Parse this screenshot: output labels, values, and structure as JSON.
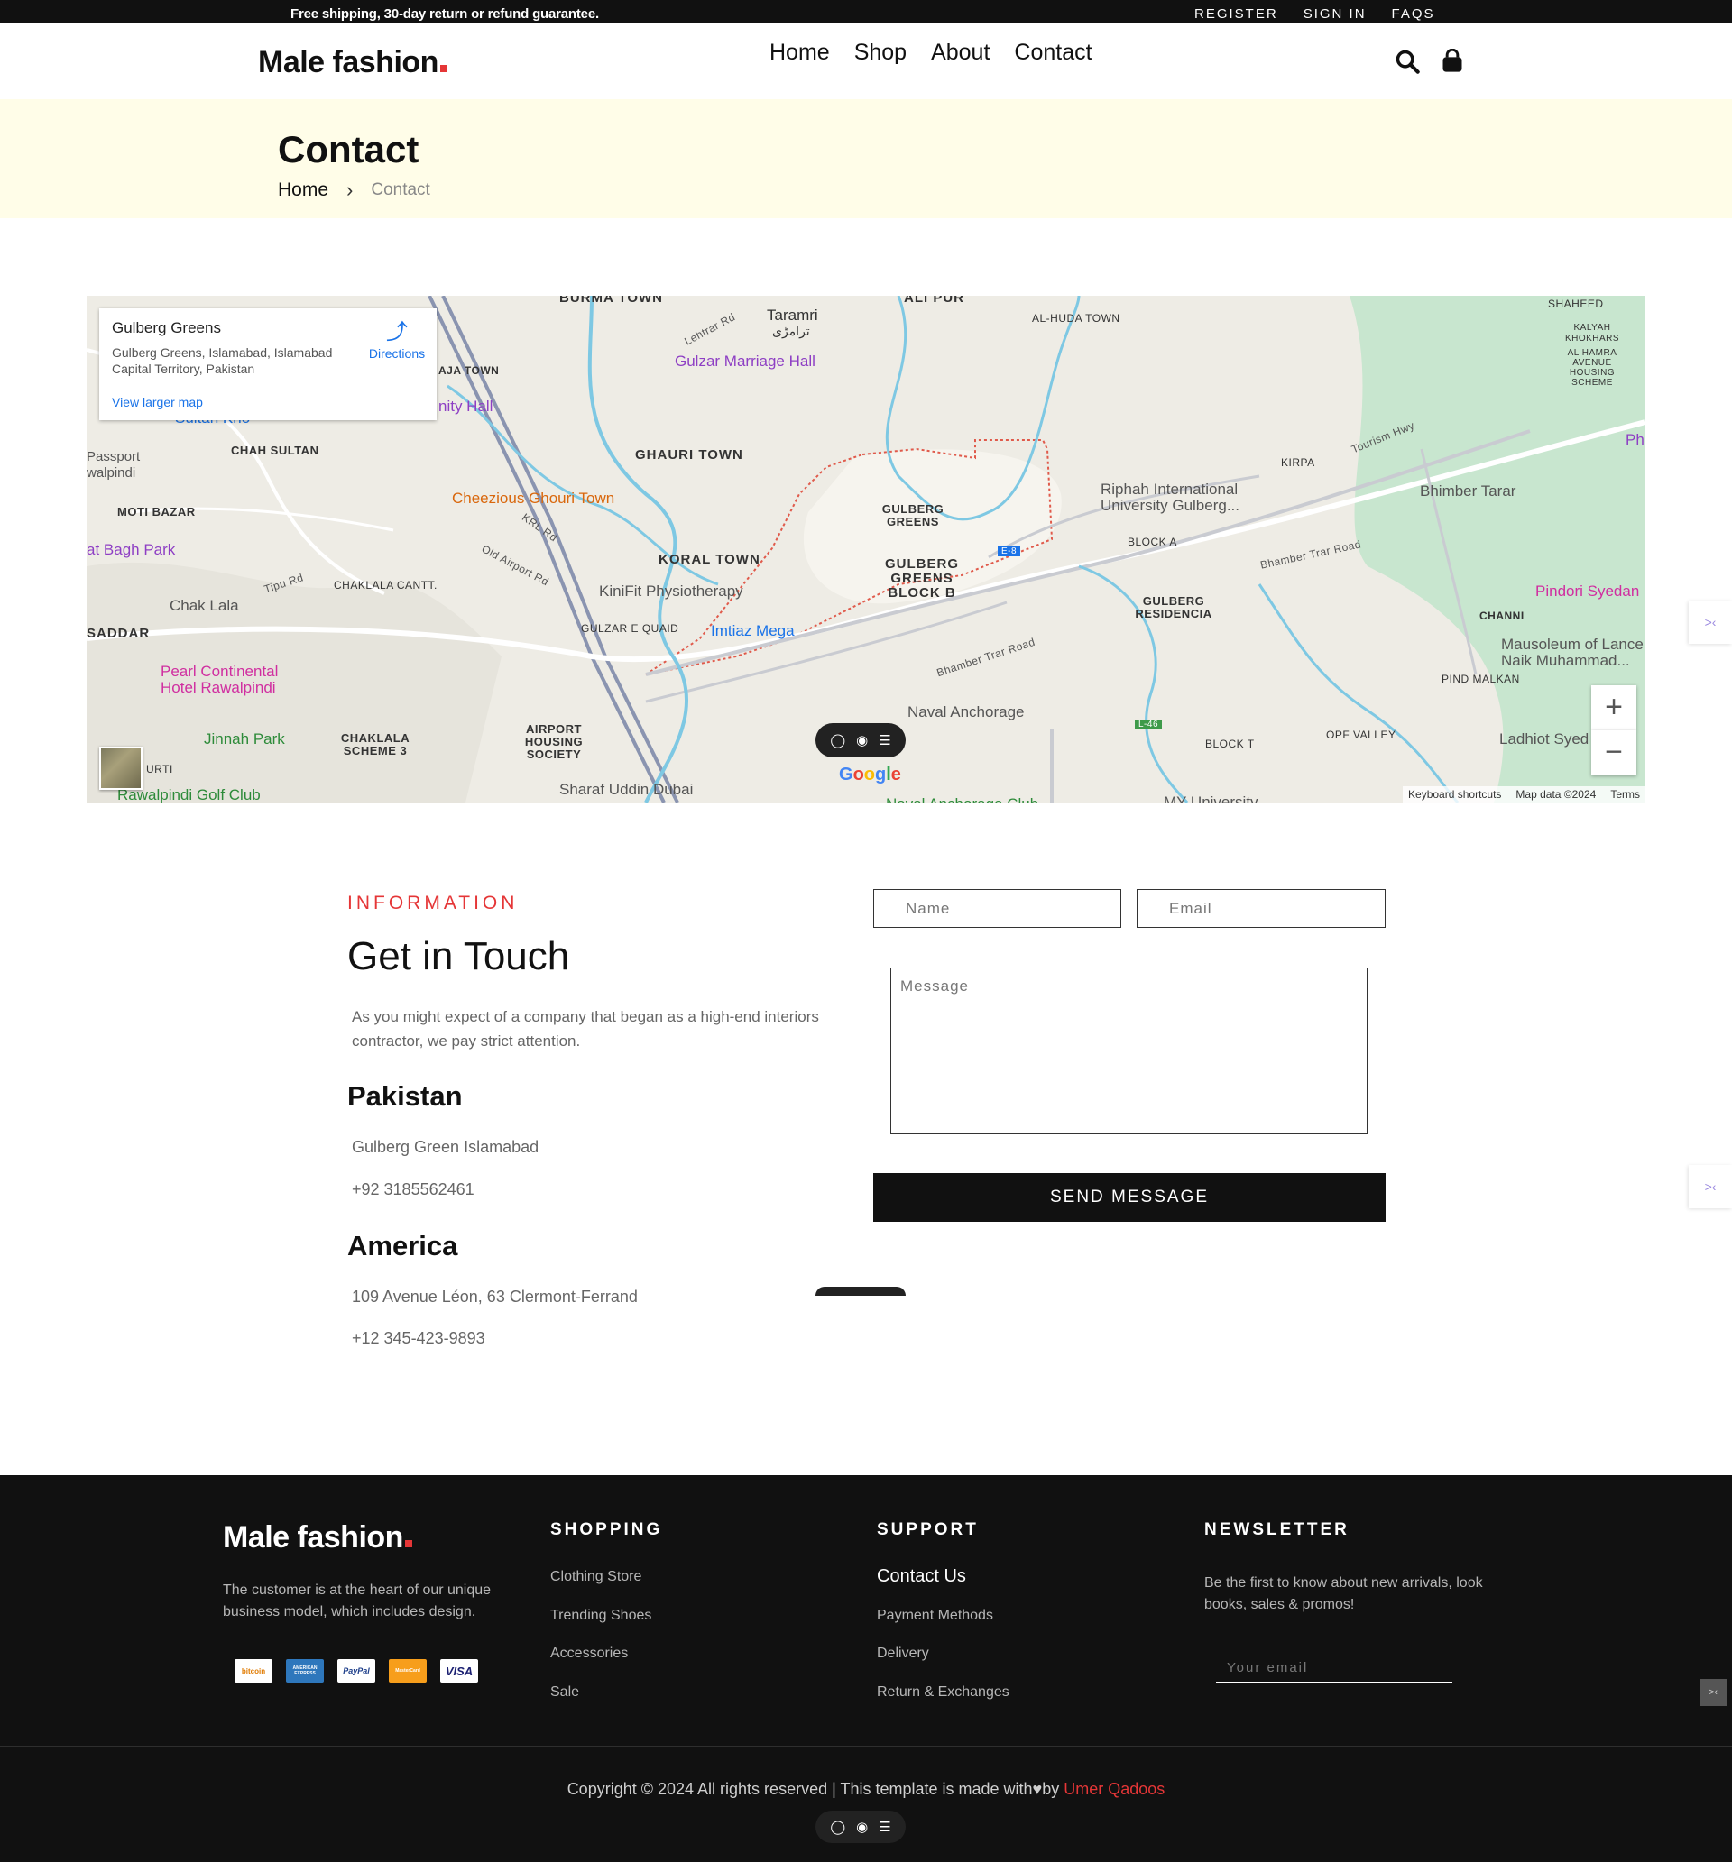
{
  "topbar": {
    "promo": "Free shipping, 30-day return or refund guarantee.",
    "links": [
      "REGISTER",
      "SIGN IN",
      "FAQS"
    ]
  },
  "header": {
    "logo_text": "Male fashion",
    "nav": [
      "Home",
      "Shop",
      "About",
      "Contact"
    ],
    "icons": [
      "search-icon",
      "shopping-bag-icon"
    ]
  },
  "breadcrumb": {
    "title": "Contact",
    "home": "Home",
    "current": "Contact"
  },
  "map": {
    "card_title": "Gulberg Greens",
    "card_address": "Gulberg Greens, Islamabad, Islamabad Capital Territory, Pakistan",
    "directions": "Directions",
    "view_larger": "View larger map",
    "footer": [
      "Keyboard shortcuts",
      "Map data ©2024",
      "Terms"
    ],
    "labels": {
      "burma_town": "BURMA TOWN",
      "ali_pur": "ALI PUR",
      "al_huda_town": "AL-HUDA TOWN",
      "shaheed": "SHAHEED",
      "kalyah_khokhars": "KALYAH KHOKHARS",
      "al_hamra": "AL HAMRA AVENUE HOUSING SCHEME",
      "taramri": "Taramri",
      "taramri_ur": "ترامڑی",
      "lehtrar_rd": "Lehtrar Rd",
      "gulzar_hall": "Gulzar Marriage Hall",
      "aja_town": "AJA TOWN",
      "nity_hall": "nity Hall",
      "sultan_kho": "Sultan Kho",
      "passport": "Passport walpindi",
      "chah_sultan": "CHAH SULTAN",
      "ghauri_town": "GHAURI TOWN",
      "kirpa": "KIRPA",
      "tourism_hwy": "Tourism Hwy",
      "ph": "Ph",
      "cheezious": "Cheezious Ghouri Town",
      "riphah": "Riphah International University Gulberg...",
      "bhimber_tarar": "Bhimber Tarar",
      "moti_bazar": "MOTI BAZAR",
      "krl_rd": "KRL Rd",
      "gulberg_greens": "GULBERG GREENS",
      "block_a": "BLOCK A",
      "bagh_park": "at Bagh Park",
      "koral_town": "KORAL TOWN",
      "old_airport": "Old Airport Rd",
      "gulberg_block_b": "GULBERG GREENS BLOCK B",
      "bhamber_trar": "Bhamber Trar Road",
      "tipu_rd": "Tipu Rd",
      "chaklala_cantt": "CHAKLALA CANTT.",
      "kinifit": "KiniFit Physiotherapy",
      "gulberg_residencia": "GULBERG RESIDENCIA",
      "pindori": "Pindori Syedan",
      "chak_lala": "Chak Lala",
      "gulzar_quaid": "GULZAR E QUAID",
      "imtiaz": "Imtiaz Mega",
      "channi": "CHANNI",
      "saddar": "SADDAR",
      "mausoleum": "Mausoleum of Lance Naik Muhammad...",
      "pearl": "Pearl Continental Hotel Rawalpindi",
      "bhamber_trar_2": "Bhamber Trar Road",
      "pind_malkan": "PIND MALKAN",
      "naval_anchorage": "Naval Anchorage",
      "l46": "L-46",
      "e8": "E-8",
      "block_t": "BLOCK T",
      "opf_valley": "OPF VALLEY",
      "ladhiot": "Ladhiot Syed",
      "jinnah_park": "Jinnah Park",
      "chaklala_3": "CHAKLALA SCHEME 3",
      "airport_housing": "AIRPORT HOUSING SOCIETY",
      "rawalpindi_golf": "Rawalpindi Golf Club",
      "sharaf": "Sharaf Uddin Dubai",
      "urti": "URTI",
      "my_university": "MY University",
      "naval_club": "Naval Anchorage Club"
    }
  },
  "contact": {
    "tag": "INFORMATION",
    "heading": "Get in Touch",
    "intro": "As you might expect of a company that began as a high-end interiors contractor, we pay strict attention.",
    "offices": [
      {
        "country": "Pakistan",
        "address": "Gulberg Green Islamabad",
        "phone": "+92 3185562461"
      },
      {
        "country": "America",
        "address": "109 Avenue Léon, 63 Clermont-Ferrand",
        "phone": "+12 345-423-9893"
      }
    ],
    "form": {
      "name_placeholder": "Name",
      "email_placeholder": "Email",
      "message_placeholder": "Message",
      "submit": "SEND MESSAGE"
    }
  },
  "footer": {
    "logo_text": "Male fashion",
    "about": "The customer is at the heart of our unique business model, which includes design.",
    "payments": [
      "bitcoin",
      "AMERICAN EXPRESS",
      "PayPal",
      "MasterCard",
      "VISA"
    ],
    "shopping": {
      "title": "SHOPPING",
      "links": [
        "Clothing Store",
        "Trending Shoes",
        "Accessories",
        "Sale"
      ]
    },
    "support": {
      "title": "SUPPORT",
      "links": [
        "Contact Us",
        "Payment Methods",
        "Delivery",
        "Return & Exchanges"
      ]
    },
    "newsletter": {
      "title": "NEWSLETTER",
      "text": "Be the first to know about new arrivals, look books, sales & promos!",
      "placeholder": "Your email"
    },
    "copyright": "Copyright © 2024 All rights reserved | This template is made with",
    "by": "by",
    "author": "Umer Qadoos"
  },
  "colors": {
    "accent": "#e53637",
    "dark": "#111111",
    "banner": "#fffde8"
  }
}
